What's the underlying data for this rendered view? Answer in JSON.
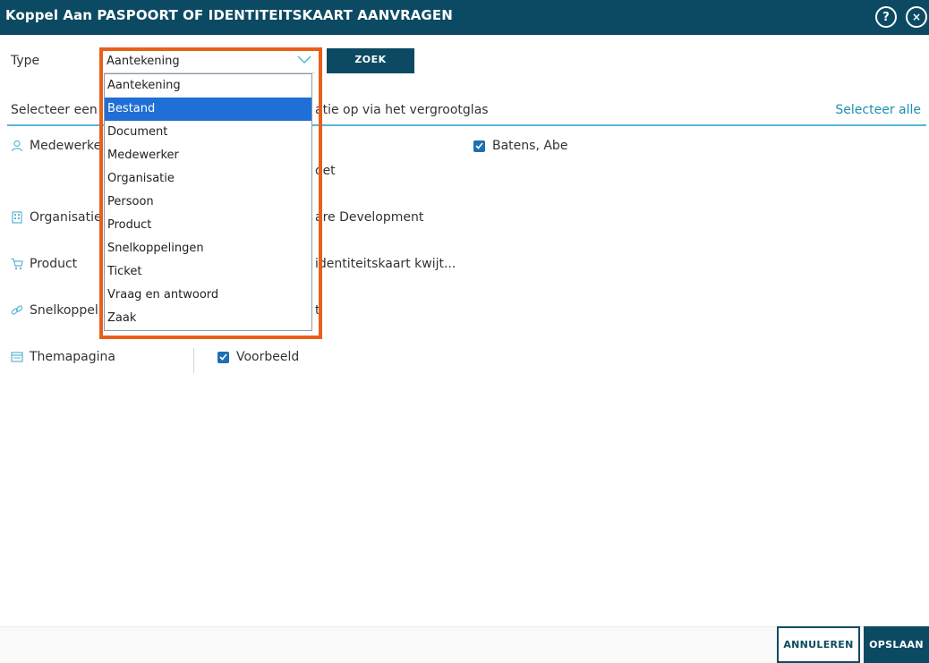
{
  "window": {
    "title": "Koppel Aan PASPOORT OF IDENTITEITSKAART AANVRAGEN",
    "help_label": "?",
    "close_label": "×"
  },
  "search": {
    "type_label": "Type",
    "selected_value": "Aantekening",
    "button_label": "ZOEK"
  },
  "instruction": {
    "text_left": "Selecteer een",
    "text_right": "atie op via het vergrootglas",
    "select_all": "Selecteer alle"
  },
  "categories": [
    {
      "label": "Medewerke",
      "icon": "user-icon"
    },
    {
      "label": "Organisatie",
      "icon": "building-icon"
    },
    {
      "label": "Product",
      "icon": "cart-icon"
    },
    {
      "label": "Snelkoppel",
      "icon": "link-icon"
    },
    {
      "label": "Themapagina",
      "icon": "calendar-icon"
    }
  ],
  "linked_items": {
    "medewerker": "Batens, Abe",
    "medewerker_partial": "oet",
    "organisatie": "are Development",
    "product": "identiteitskaart kwijt...",
    "snelkoppeling": "t",
    "themapagina": "Voorbeeld"
  },
  "dropdown": {
    "options": [
      "Aantekening",
      "Bestand",
      "Document",
      "Medewerker",
      "Organisatie",
      "Persoon",
      "Product",
      "Snelkoppelingen",
      "Ticket",
      "Vraag en antwoord",
      "Zaak"
    ],
    "highlighted_index": 1
  },
  "footer": {
    "cancel_label": "ANNULEREN",
    "save_label": "OPSLAAN"
  },
  "colors": {
    "header": "#0c4a63",
    "accent": "#1a8fb0",
    "highlight": "#1f6fd6",
    "outline": "#e8601c"
  }
}
